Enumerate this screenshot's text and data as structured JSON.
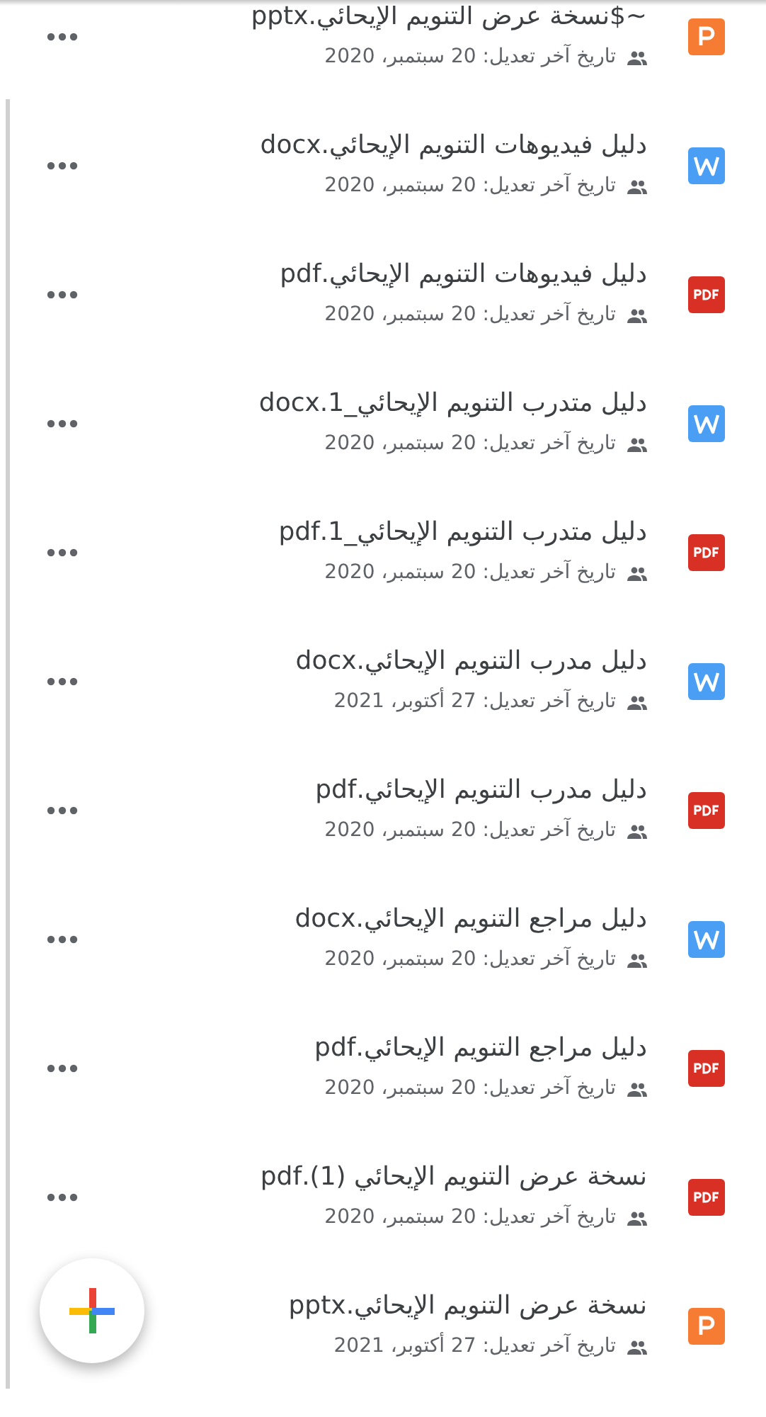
{
  "files": [
    {
      "name": "~$نسخة عرض التنويم الإيحائي.pptx",
      "kind": "pptx",
      "shared": true,
      "modified": "تاريخ آخر تعديل: 20 سبتمبر، 2020"
    },
    {
      "name": "دليل فيديوهات التنويم الإيحائي.docx",
      "kind": "docx",
      "shared": true,
      "modified": "تاريخ آخر تعديل: 20 سبتمبر، 2020"
    },
    {
      "name": "دليل فيديوهات التنويم الإيحائي.pdf",
      "kind": "pdf",
      "shared": true,
      "modified": "تاريخ آخر تعديل: 20 سبتمبر، 2020"
    },
    {
      "name": "دليل متدرب التنويم الإيحائي_1.docx",
      "kind": "docx",
      "shared": true,
      "modified": "تاريخ آخر تعديل: 20 سبتمبر، 2020"
    },
    {
      "name": "دليل متدرب التنويم الإيحائي_1.pdf",
      "kind": "pdf",
      "shared": true,
      "modified": "تاريخ آخر تعديل: 20 سبتمبر، 2020"
    },
    {
      "name": "دليل مدرب التنويم الإيحائي.docx",
      "kind": "docx",
      "shared": true,
      "modified": "تاريخ آخر تعديل: 27 أكتوبر، 2021"
    },
    {
      "name": "دليل مدرب التنويم الإيحائي.pdf",
      "kind": "pdf",
      "shared": true,
      "modified": "تاريخ آخر تعديل: 20 سبتمبر، 2020"
    },
    {
      "name": "دليل مراجع التنويم الإيحائي.docx",
      "kind": "docx",
      "shared": true,
      "modified": "تاريخ آخر تعديل: 20 سبتمبر، 2020"
    },
    {
      "name": "دليل مراجع التنويم الإيحائي.pdf",
      "kind": "pdf",
      "shared": true,
      "modified": "تاريخ آخر تعديل: 20 سبتمبر، 2020"
    },
    {
      "name": "نسخة عرض التنويم الإيحائي (1).pdf",
      "kind": "pdf",
      "shared": true,
      "modified": "تاريخ آخر تعديل: 20 سبتمبر، 2020"
    },
    {
      "name": "نسخة عرض التنويم الإيحائي.pptx",
      "kind": "pptx",
      "shared": true,
      "menu_visible": false,
      "modified": "تاريخ آخر تعديل: 27 أكتوبر، 2021"
    }
  ]
}
